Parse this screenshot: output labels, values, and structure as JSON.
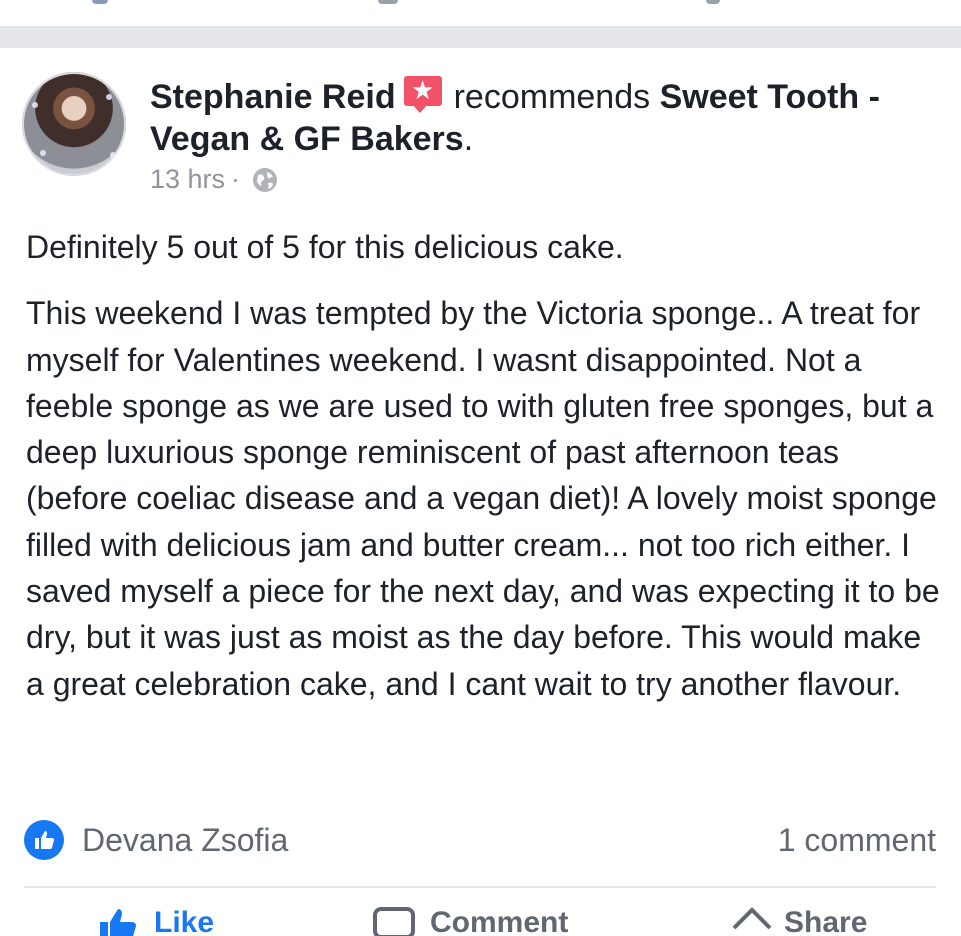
{
  "post": {
    "author": "Stephanie Reid",
    "verb": "recommends",
    "page_name": "Sweet Tooth - Vegan & GF Bakers",
    "timestamp": "13 hrs",
    "separator": "·",
    "paragraphs": [
      "Definitely 5 out of 5 for this delicious cake.",
      "This weekend I was tempted by the Victoria sponge.. A treat for myself for Valentines weekend. I wasnt disappointed. Not a feeble sponge as we are used to with gluten free sponges, but a deep luxurious sponge reminiscent of past afternoon teas (before coeliac disease and a vegan diet)! A lovely moist sponge filled with delicious jam and butter cream... not too rich either. I saved myself a piece for the next day, and was expecting it to be dry, but it was just as moist as the day before. This would make a great celebration cake, and I cant wait to try another flavour."
    ],
    "reactions": {
      "icon": "like-icon",
      "name": "Devana Zsofia",
      "comments": "1 comment"
    },
    "actions": [
      {
        "label": "Like",
        "icon": "thumbs-up-icon"
      },
      {
        "label": "Comment",
        "icon": "comment-icon"
      },
      {
        "label": "Share",
        "icon": "share-icon"
      }
    ]
  },
  "colors": {
    "text": "#1d2129",
    "secondary": "#606770",
    "meta": "#90949c",
    "accent": "#1877f2",
    "recommend_badge": "#f25268",
    "divider": "#e4e6eb"
  }
}
